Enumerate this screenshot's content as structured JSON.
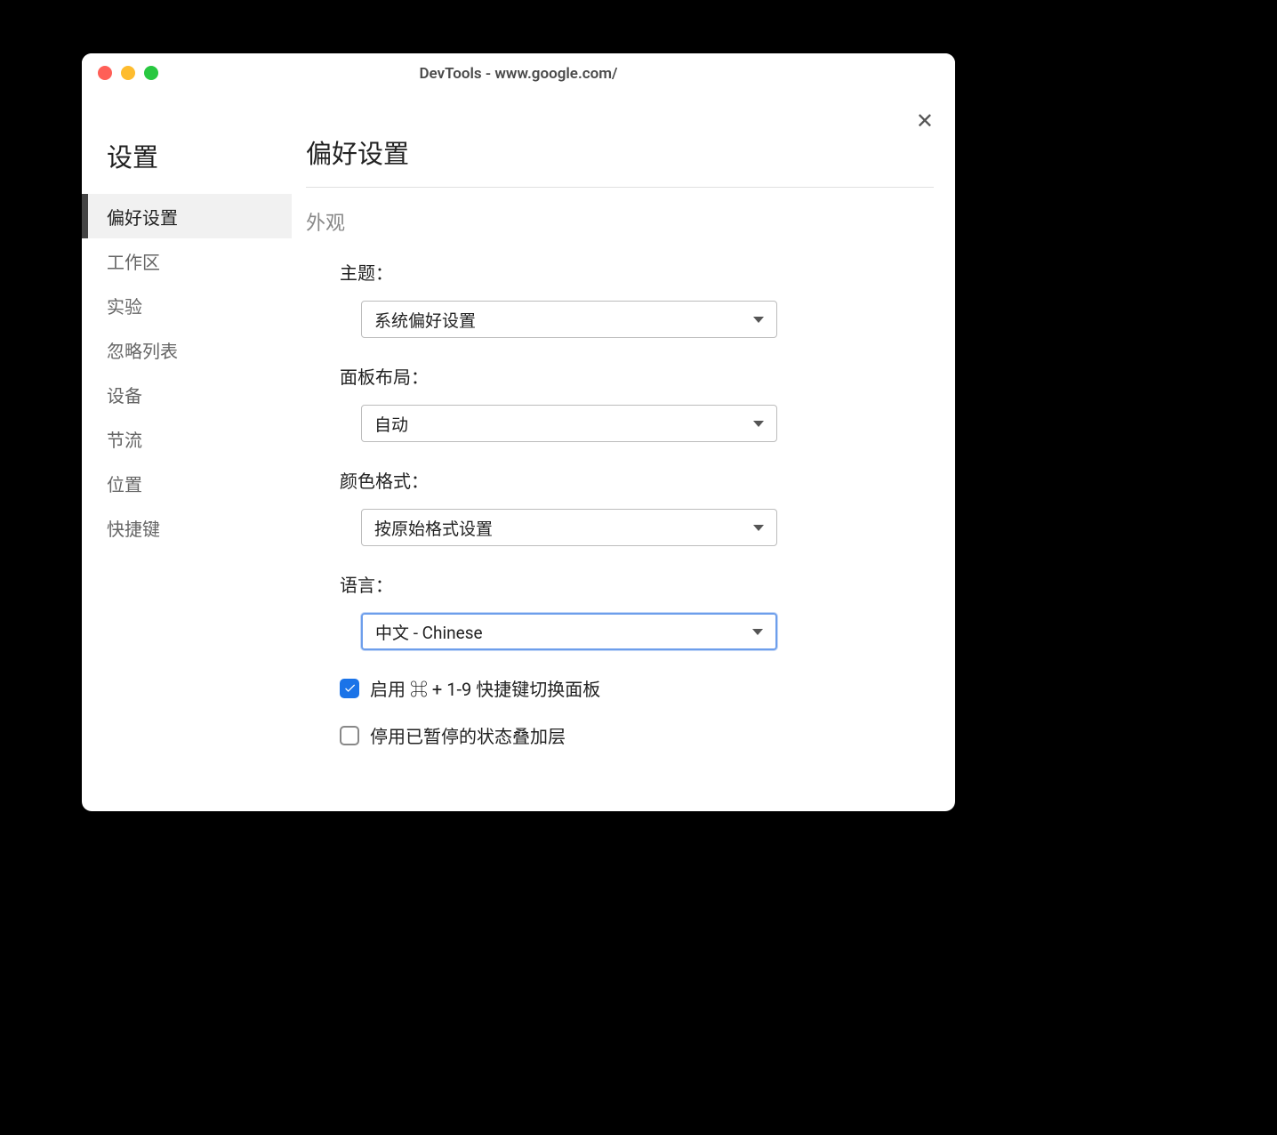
{
  "window": {
    "title": "DevTools - www.google.com/"
  },
  "sidebar": {
    "title": "设置",
    "items": [
      {
        "label": "偏好设置",
        "selected": true
      },
      {
        "label": "工作区",
        "selected": false
      },
      {
        "label": "实验",
        "selected": false
      },
      {
        "label": "忽略列表",
        "selected": false
      },
      {
        "label": "设备",
        "selected": false
      },
      {
        "label": "节流",
        "selected": false
      },
      {
        "label": "位置",
        "selected": false
      },
      {
        "label": "快捷键",
        "selected": false
      }
    ]
  },
  "main": {
    "title": "偏好设置",
    "section": "外观",
    "theme": {
      "label": "主题：",
      "value": "系统偏好设置"
    },
    "panel_layout": {
      "label": "面板布局：",
      "value": "自动"
    },
    "color_format": {
      "label": "颜色格式：",
      "value": "按原始格式设置"
    },
    "language": {
      "label": "语言：",
      "value": "中文 - Chinese"
    },
    "enable_shortcut": {
      "checked": true,
      "label": "启用 ⌘ + 1-9 快捷键切换面板"
    },
    "disable_overlay": {
      "checked": false,
      "label": "停用已暂停的状态叠加层"
    }
  }
}
